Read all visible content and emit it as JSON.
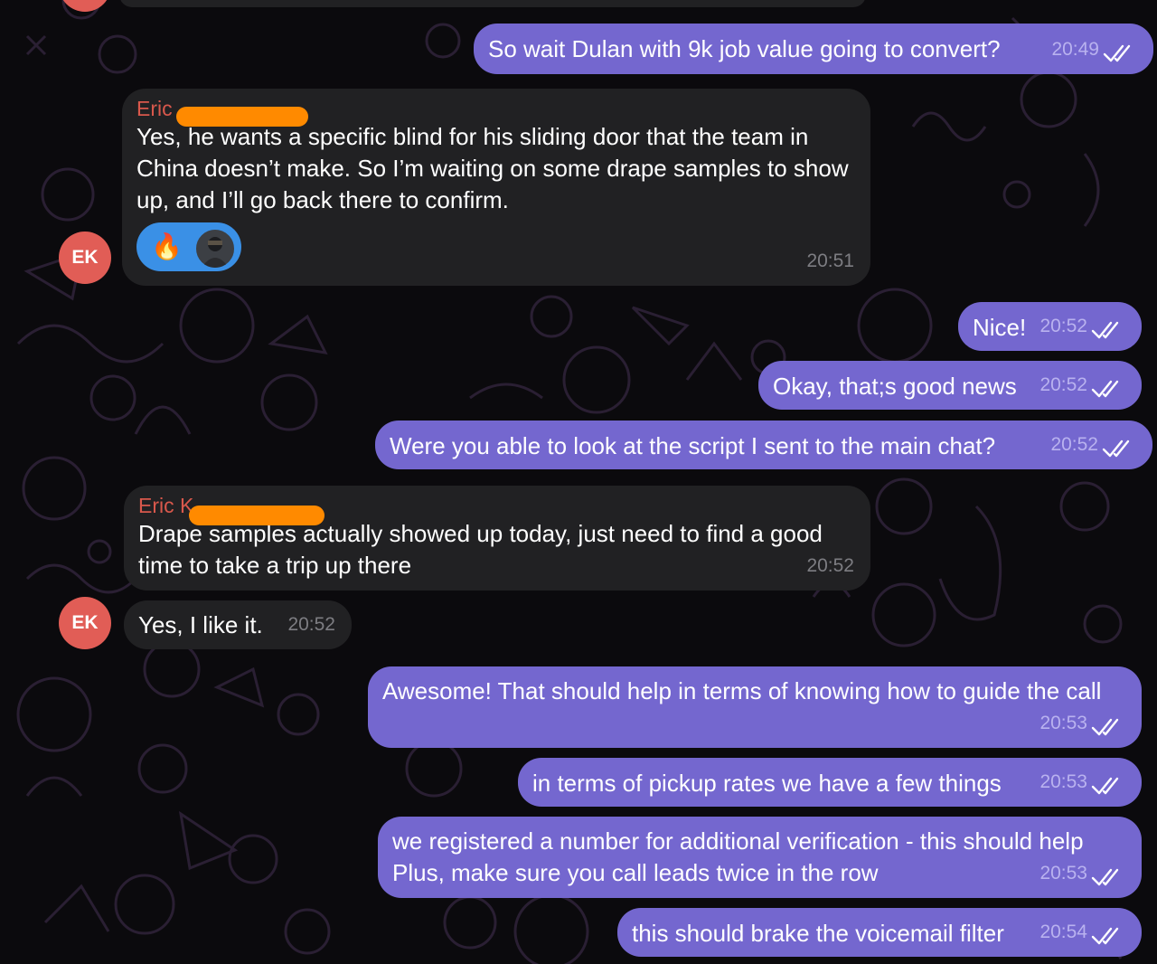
{
  "colors": {
    "background": "#0b0a0d",
    "outgoing_bubble": "#7467cf",
    "incoming_bubble": "#212123",
    "sender_name": "#d9584c",
    "avatar": "#e15d56",
    "reaction": "#3a90e6"
  },
  "contact": {
    "initials": "EK",
    "sender_names": [
      "Eric",
      "Eric K"
    ]
  },
  "messages": [
    {
      "id": 1,
      "direction": "outgoing",
      "text": "So wait Dulan with 9k job value going to convert?",
      "time": "20:49",
      "status": "read"
    },
    {
      "id": 2,
      "direction": "incoming",
      "sender": "Eric",
      "text": "Yes, he wants a specific blind for his sliding door that the team in China doesn’t make. So I’m waiting on some drape samples to show up, and I’ll go back there to confirm.",
      "time": "20:51",
      "reaction": {
        "emoji": "🔥",
        "icon": "reactor-avatar"
      }
    },
    {
      "id": 3,
      "direction": "outgoing",
      "text": "Nice!",
      "time": "20:52",
      "status": "read"
    },
    {
      "id": 4,
      "direction": "outgoing",
      "text": "Okay, that;s good news",
      "time": "20:52",
      "status": "read"
    },
    {
      "id": 5,
      "direction": "outgoing",
      "text": "Were you able to look at the script I sent to the main chat?",
      "time": "20:52",
      "status": "read"
    },
    {
      "id": 6,
      "direction": "incoming",
      "sender": "Eric K",
      "text": "Drape samples actually showed up today, just need to find a good time to take a trip up there",
      "time": "20:52"
    },
    {
      "id": 7,
      "direction": "incoming",
      "text": "Yes, I like it.",
      "time": "20:52"
    },
    {
      "id": 8,
      "direction": "outgoing",
      "text": "Awesome! That should help in terms of knowing how to guide the call",
      "time": "20:53",
      "status": "read"
    },
    {
      "id": 9,
      "direction": "outgoing",
      "text": "in terms of pickup rates we have a few things",
      "time": "20:53",
      "status": "read"
    },
    {
      "id": 10,
      "direction": "outgoing",
      "text": "we registered a number for additional verification - this should help\nPlus, make sure you call leads twice in the row",
      "time": "20:53",
      "status": "read"
    },
    {
      "id": 11,
      "direction": "outgoing",
      "text": "this should brake the voicemail filter",
      "time": "20:54",
      "status": "read"
    }
  ]
}
